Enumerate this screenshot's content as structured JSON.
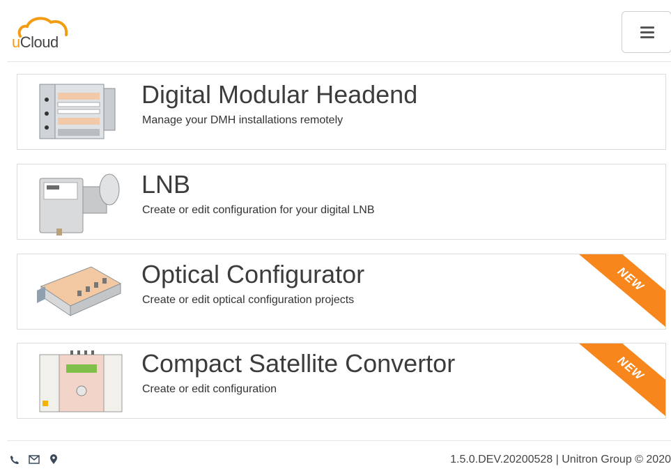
{
  "header": {
    "logo": {
      "prefix": "u",
      "rest": "Cloud",
      "icon": "cloud-logo-icon"
    },
    "menu_icon": "hamburger-menu-icon"
  },
  "colors": {
    "accent": "#f7861c",
    "logo_orange": "#f39c12",
    "border": "#dcdcdc"
  },
  "cards": [
    {
      "title": "Digital Modular Headend",
      "description": "Manage your DMH installations remotely",
      "badge": ""
    },
    {
      "title": "LNB",
      "description": "Create or edit configuration for your digital LNB",
      "badge": ""
    },
    {
      "title": "Optical Configurator",
      "description": "Create or edit optical configuration projects",
      "badge": "NEW"
    },
    {
      "title": "Compact Satellite Convertor",
      "description": "Create or edit configuration",
      "badge": "NEW"
    }
  ],
  "footer": {
    "icons": [
      "phone-icon",
      "mail-icon",
      "location-pin-icon"
    ],
    "version": "1.5.0.DEV.20200528 | Unitron Group © 2020"
  }
}
